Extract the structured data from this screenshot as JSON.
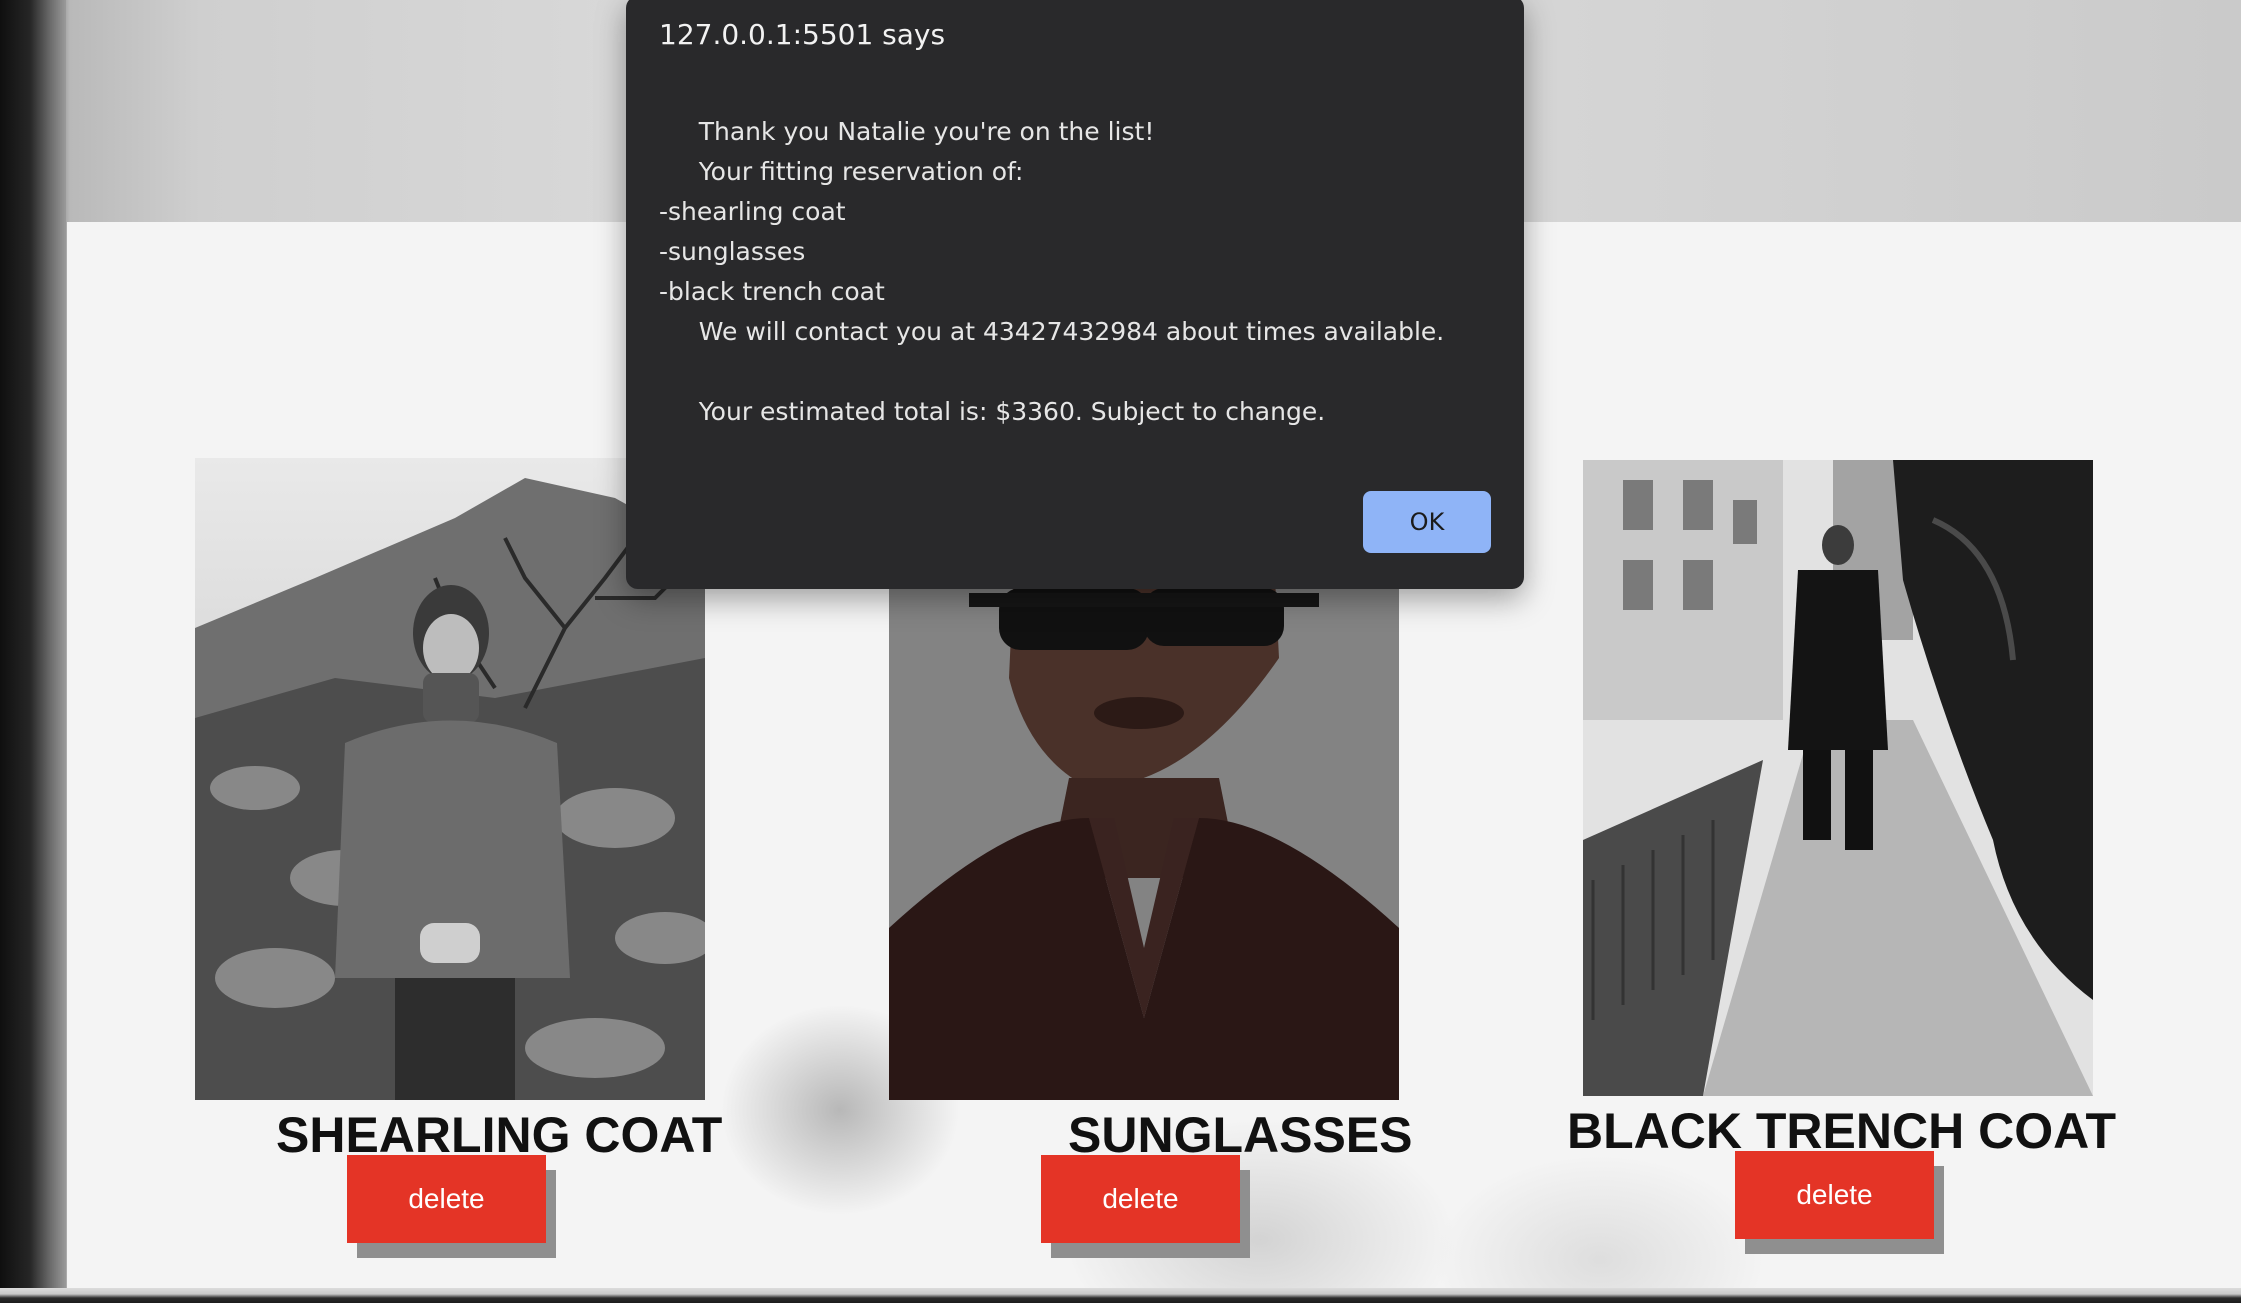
{
  "dialog": {
    "title": "127.0.0.1:5501 says",
    "message": "     Thank you Natalie you're on the list!\n     Your fitting reservation of:\n-shearling coat\n-sunglasses\n-black trench coat\n     We will contact you at 43427432984 about times available.\n\n     Your estimated total is: $3360. Subject to change.",
    "ok_label": "OK"
  },
  "products": [
    {
      "name": "SHEARLING COAT",
      "delete_label": "delete",
      "image_icon": "shearling-coat-photo"
    },
    {
      "name": "SUNGLASSES",
      "delete_label": "delete",
      "image_icon": "sunglasses-photo"
    },
    {
      "name": "BLACK TRENCH COAT",
      "delete_label": "delete",
      "image_icon": "black-trench-coat-photo"
    }
  ],
  "colors": {
    "delete_button": "#e43426",
    "ok_button": "#8fb4f7",
    "dialog_bg": "#29292b"
  }
}
